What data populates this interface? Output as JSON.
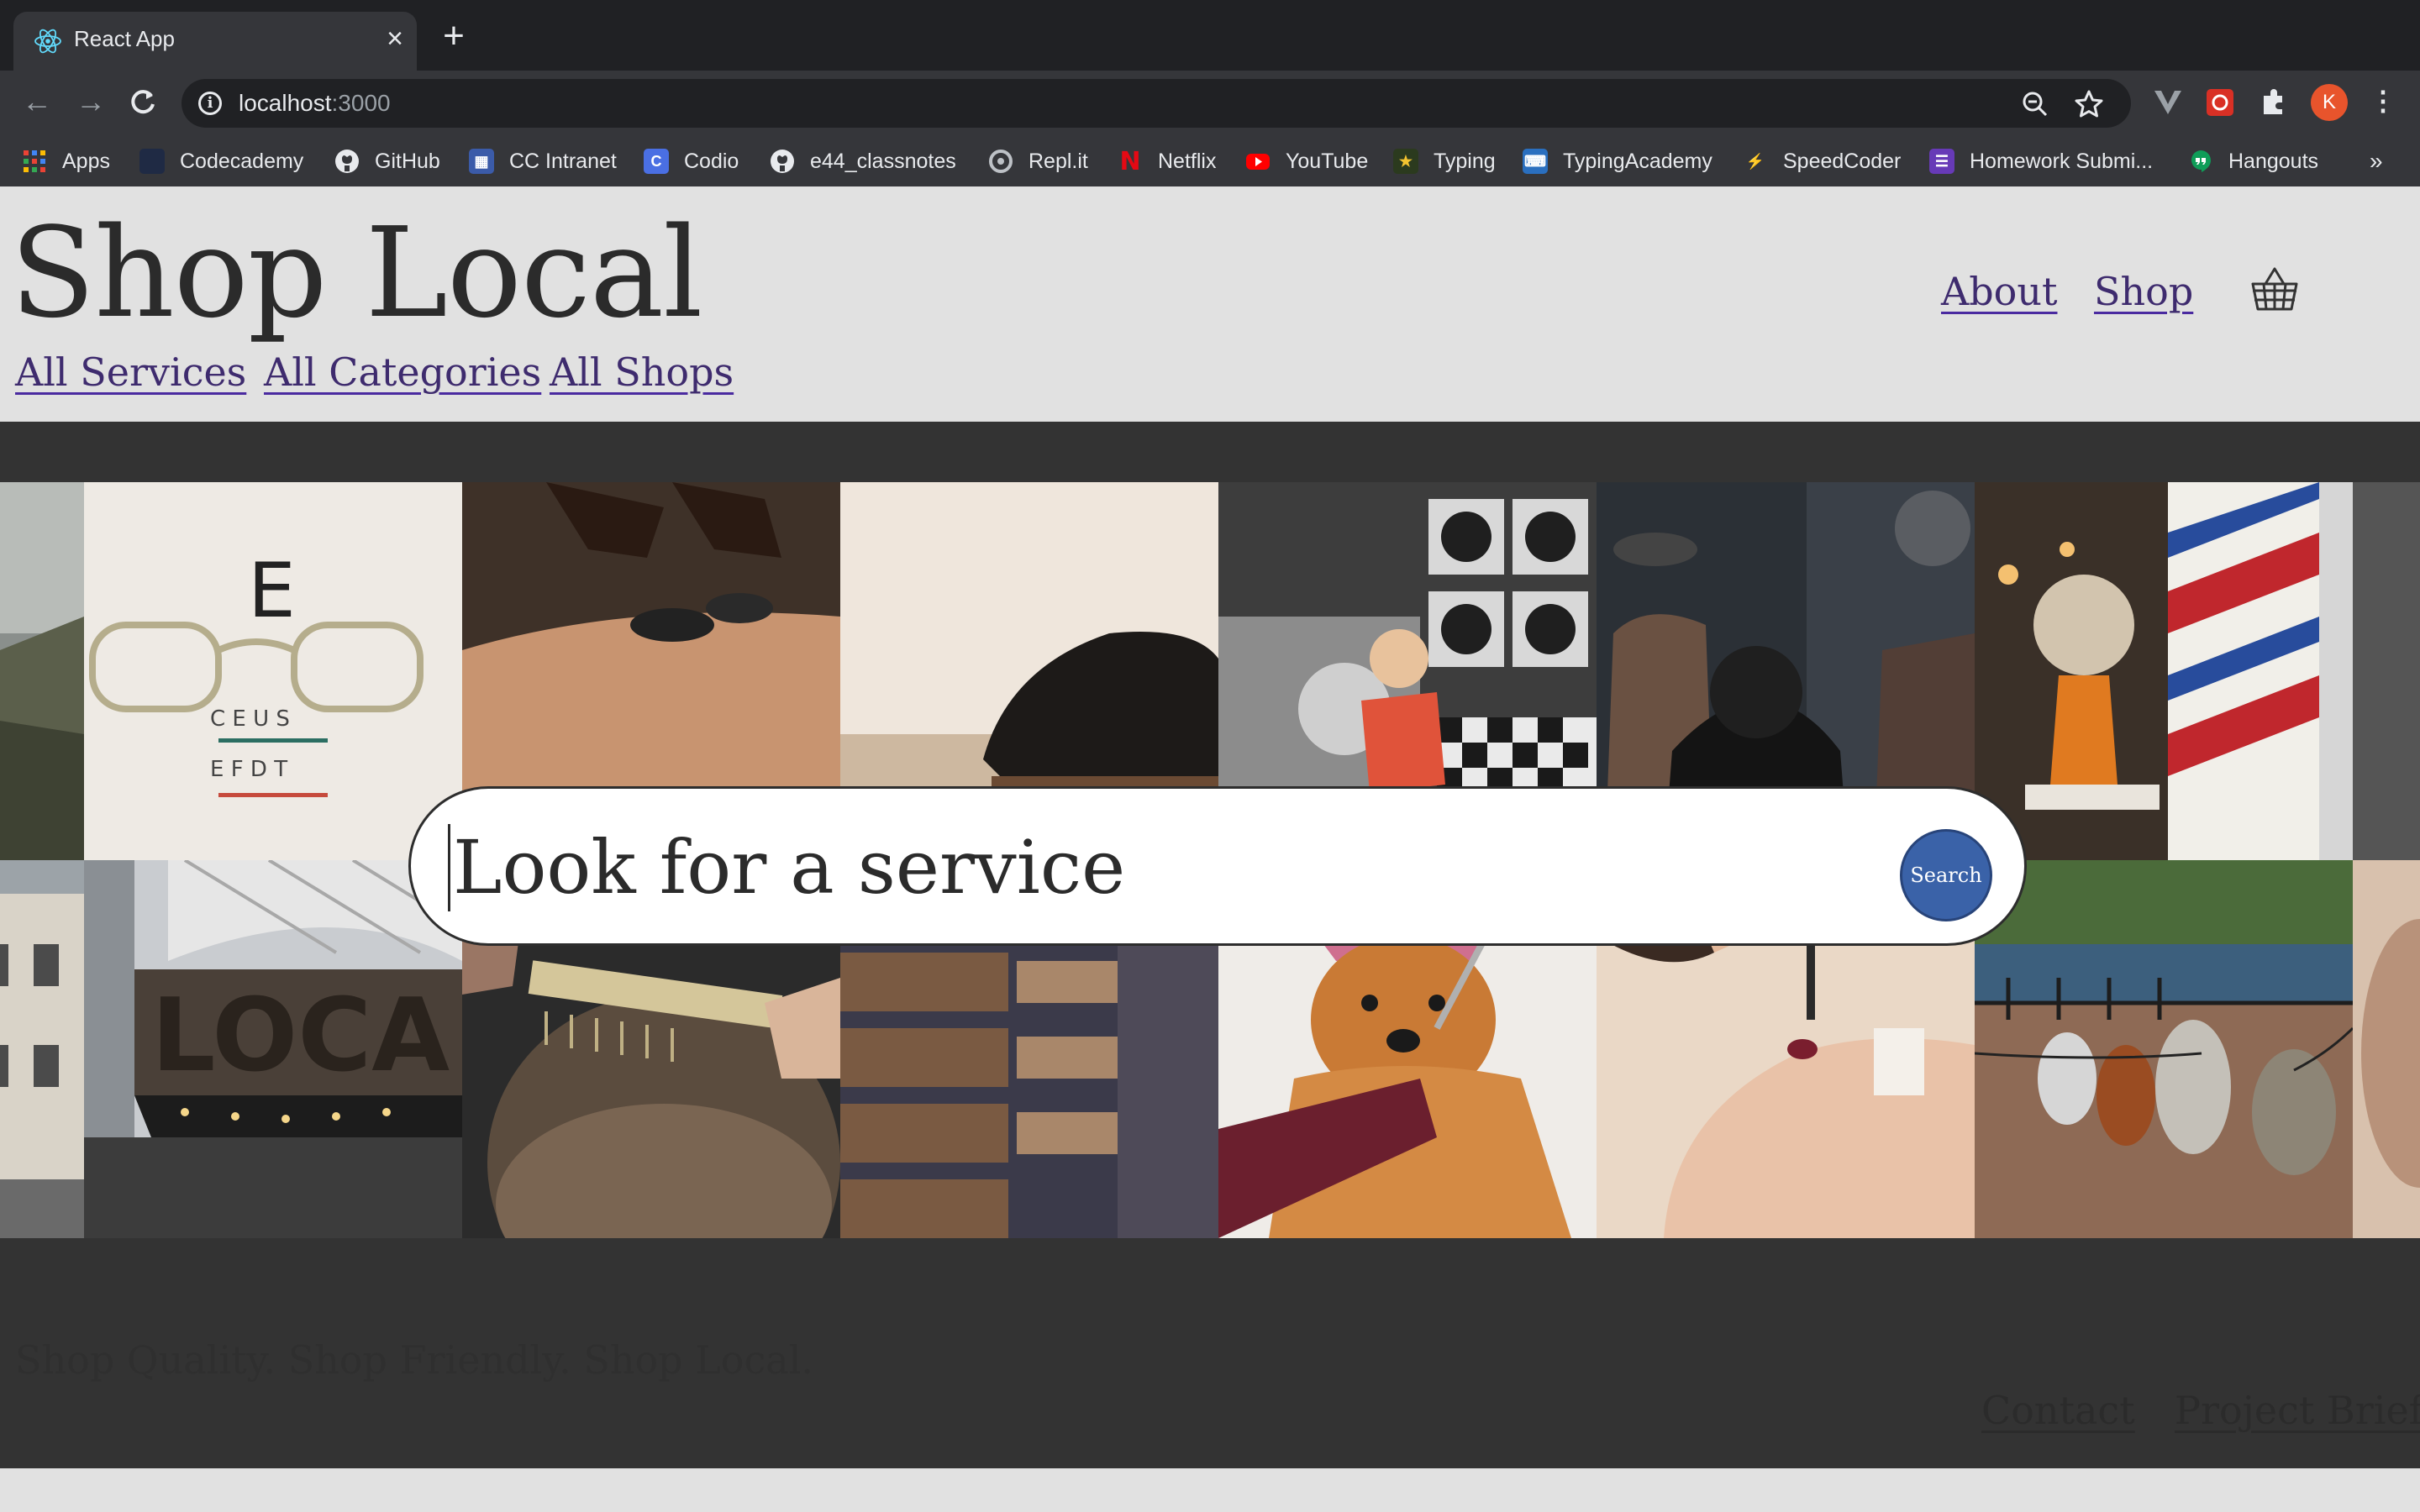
{
  "browser": {
    "tab_title": "React App",
    "url_host": "localhost",
    "url_port": ":3000",
    "profile_initial": "K",
    "bookmarks": [
      {
        "label": "Apps",
        "icon": "apps-grid-icon"
      },
      {
        "label": "Codecademy",
        "icon": "codecademy-icon"
      },
      {
        "label": "GitHub",
        "icon": "github-icon"
      },
      {
        "label": "CC Intranet",
        "icon": "intranet-icon"
      },
      {
        "label": "Codio",
        "icon": "codio-icon"
      },
      {
        "label": "e44_classnotes",
        "icon": "github-icon"
      },
      {
        "label": "Repl.it",
        "icon": "replit-icon"
      },
      {
        "label": "Netflix",
        "icon": "netflix-icon"
      },
      {
        "label": "YouTube",
        "icon": "youtube-icon"
      },
      {
        "label": "Typing",
        "icon": "typing-icon"
      },
      {
        "label": "TypingAcademy",
        "icon": "typingacademy-icon"
      },
      {
        "label": "SpeedCoder",
        "icon": "lightning-icon"
      },
      {
        "label": "Homework Submi...",
        "icon": "list-icon"
      },
      {
        "label": "Hangouts",
        "icon": "hangouts-icon"
      }
    ],
    "bookmarks_more": "»"
  },
  "header": {
    "brand": "Shop Local",
    "subnav": [
      "All Services",
      "All Categories",
      "All Shops"
    ],
    "topnav": [
      "About",
      "Shop"
    ],
    "cart_icon": "basket-icon"
  },
  "hero": {
    "tiles": [
      "mountains",
      "eye-chart-glasses",
      "hot-stone-massage",
      "leather-shoe",
      "laundromat",
      "barbershop-haircut",
      "shaving-brush-barber-pole",
      "street",
      "local-sign",
      "haircut-comb",
      "bookshelves",
      "groomed-dog",
      "manicure",
      "dogs-on-leash",
      "person"
    ]
  },
  "search": {
    "placeholder": "Look for a service",
    "button_label": "Search"
  },
  "footer": {
    "tagline": "Shop Quality. Shop Friendly. Shop Local.",
    "links": [
      "Contact",
      "Project Brief"
    ]
  },
  "colors": {
    "link": "#3e2b6e",
    "search_button": "#3a62a8",
    "band": "#333333",
    "page_bg": "#e1e1e1"
  }
}
